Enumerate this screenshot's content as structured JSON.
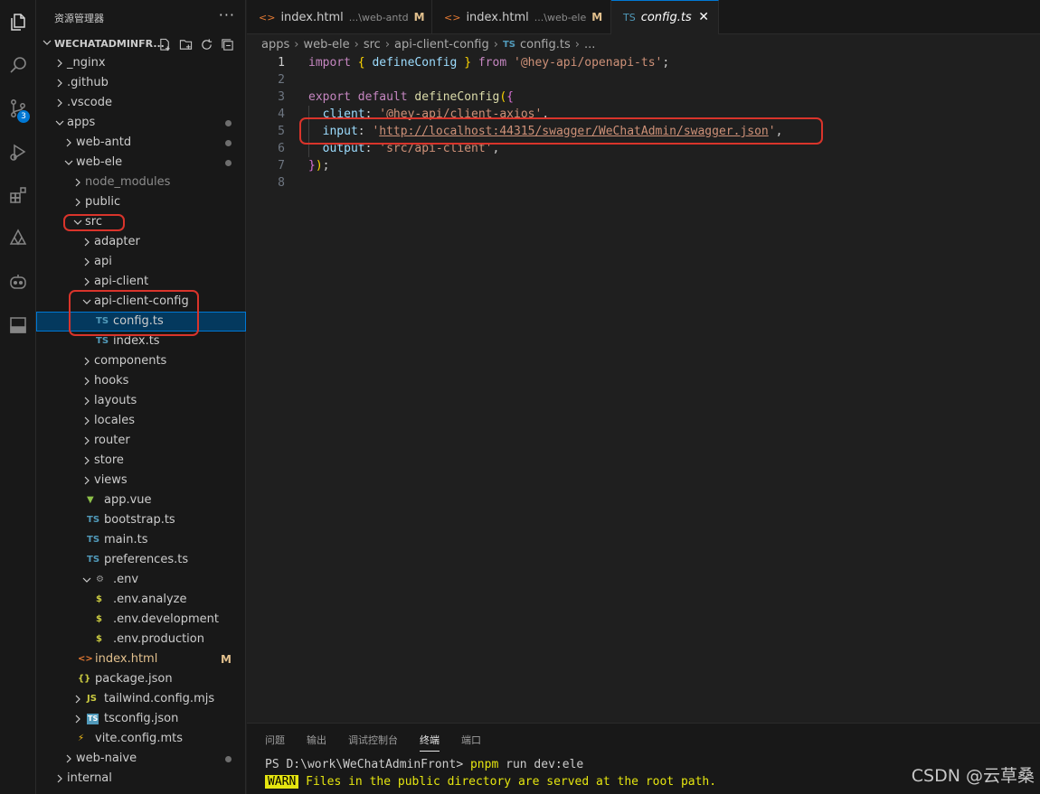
{
  "sidebar": {
    "title": "资源管理器",
    "more": "···",
    "section_title": "WECHATADMINFR...",
    "tree": [
      {
        "label": "_nginx",
        "kind": "folder",
        "open": false,
        "depth": 0
      },
      {
        "label": ".github",
        "kind": "folder",
        "open": false,
        "depth": 0
      },
      {
        "label": ".vscode",
        "kind": "folder",
        "open": false,
        "depth": 0
      },
      {
        "label": "apps",
        "kind": "folder",
        "open": true,
        "depth": 0,
        "dot": true
      },
      {
        "label": "web-antd",
        "kind": "folder",
        "open": false,
        "depth": 1,
        "dot": true
      },
      {
        "label": "web-ele",
        "kind": "folder",
        "open": true,
        "depth": 1,
        "dot": true
      },
      {
        "label": "node_modules",
        "kind": "folder",
        "open": false,
        "depth": 2,
        "dim": true
      },
      {
        "label": "public",
        "kind": "folder",
        "open": false,
        "depth": 2
      },
      {
        "label": "src",
        "kind": "folder",
        "open": true,
        "depth": 2
      },
      {
        "label": "adapter",
        "kind": "folder",
        "open": false,
        "depth": 3
      },
      {
        "label": "api",
        "kind": "folder",
        "open": false,
        "depth": 3
      },
      {
        "label": "api-client",
        "kind": "folder",
        "open": false,
        "depth": 3
      },
      {
        "label": "api-client-config",
        "kind": "folder",
        "open": true,
        "depth": 3
      },
      {
        "label": "config.ts",
        "kind": "ts",
        "depth": 4,
        "selected": true
      },
      {
        "label": "index.ts",
        "kind": "ts",
        "depth": 4
      },
      {
        "label": "components",
        "kind": "folder",
        "open": false,
        "depth": 3
      },
      {
        "label": "hooks",
        "kind": "folder",
        "open": false,
        "depth": 3
      },
      {
        "label": "layouts",
        "kind": "folder",
        "open": false,
        "depth": 3
      },
      {
        "label": "locales",
        "kind": "folder",
        "open": false,
        "depth": 3
      },
      {
        "label": "router",
        "kind": "folder",
        "open": false,
        "depth": 3
      },
      {
        "label": "store",
        "kind": "folder",
        "open": false,
        "depth": 3
      },
      {
        "label": "views",
        "kind": "folder",
        "open": false,
        "depth": 3
      },
      {
        "label": "app.vue",
        "kind": "vue",
        "depth": 3
      },
      {
        "label": "bootstrap.ts",
        "kind": "ts",
        "depth": 3
      },
      {
        "label": "main.ts",
        "kind": "ts",
        "depth": 3
      },
      {
        "label": "preferences.ts",
        "kind": "ts",
        "depth": 3
      },
      {
        "label": ".env",
        "kind": "gear",
        "open": true,
        "depth": 3
      },
      {
        "label": ".env.analyze",
        "kind": "env",
        "depth": 4
      },
      {
        "label": ".env.development",
        "kind": "env",
        "depth": 4
      },
      {
        "label": ".env.production",
        "kind": "env",
        "depth": 4
      },
      {
        "label": "index.html",
        "kind": "html",
        "depth": 2,
        "mark": "M",
        "orange": true
      },
      {
        "label": "package.json",
        "kind": "json",
        "depth": 2
      },
      {
        "label": "tailwind.config.mjs",
        "kind": "js",
        "open": false,
        "depth": 2
      },
      {
        "label": "tsconfig.json",
        "kind": "tsconfig",
        "open": false,
        "depth": 2
      },
      {
        "label": "vite.config.mts",
        "kind": "vite",
        "depth": 2
      },
      {
        "label": "web-naive",
        "kind": "folder",
        "open": false,
        "depth": 1,
        "dot": true
      },
      {
        "label": "internal",
        "kind": "folder",
        "open": false,
        "depth": 0
      }
    ]
  },
  "tabs": [
    {
      "name": "index.html",
      "desc": "...\\web-antd",
      "mark": "M",
      "icon": "<>"
    },
    {
      "name": "index.html",
      "desc": "...\\web-ele",
      "mark": "M",
      "icon": "<>"
    },
    {
      "name": "config.ts",
      "desc": "",
      "mark": "",
      "icon": "TS",
      "close": "✕"
    }
  ],
  "breadcrumb": [
    "apps",
    "web-ele",
    "src",
    "api-client-config",
    "config.ts",
    "..."
  ],
  "breadcrumb_ts_icon": "TS",
  "editor": {
    "line_numbers": [
      "1",
      "2",
      "3",
      "4",
      "5",
      "6",
      "7",
      "8"
    ],
    "lines": [
      "import { defineConfig } from '@hey-api/openapi-ts';",
      "",
      "export default defineConfig({",
      "  client: '@hey-api/client-axios',",
      "  input: 'http://localhost:44315/swagger/WeChatAdmin/swagger.json',",
      "  output: 'src/api-client',",
      "});",
      ""
    ]
  },
  "panel": {
    "tabs": [
      "问题",
      "输出",
      "调试控制台",
      "终端",
      "端口"
    ],
    "active_tab": "终端",
    "prompt": "PS D:\\work\\WeChatAdminFront> ",
    "command": "pnpm",
    "command_args": " run dev:ele",
    "warn_badge": "WARN",
    "warn_text": " Files in the public directory are served at the root path."
  },
  "watermark": "CSDN @云草桑",
  "colors": {
    "accent": "#0078d4",
    "highlight_box": "#d9342b",
    "ts_icon": "#519aba",
    "html_icon": "#e37933",
    "vue_icon": "#8dc149",
    "env_icon": "#cbcb41",
    "json_icon": "#cbcb41"
  }
}
